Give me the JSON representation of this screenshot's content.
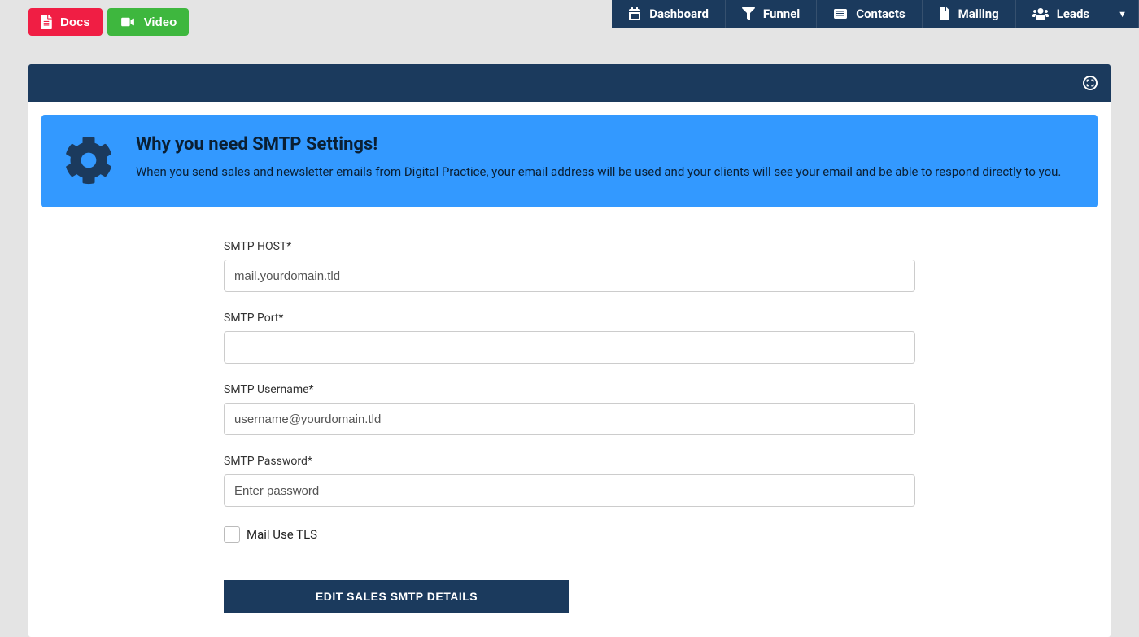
{
  "topButtons": {
    "docs": "Docs",
    "video": "Video"
  },
  "nav": {
    "dashboard": "Dashboard",
    "funnel": "Funnel",
    "contacts": "Contacts",
    "mailing": "Mailing",
    "leads": "Leads"
  },
  "banner": {
    "title": "Why you need SMTP Settings!",
    "body": "When you send sales and newsletter emails from Digital Practice, your email address will be used and your clients will see your email and be able to respond directly to you."
  },
  "form": {
    "host_label": "SMTP HOST*",
    "host_placeholder": "mail.yourdomain.tld",
    "port_label": "SMTP Port*",
    "port_value": "",
    "username_label": "SMTP Username*",
    "username_placeholder": "username@yourdomain.tld",
    "password_label": "SMTP Password*",
    "password_placeholder": "Enter password",
    "tls_label": "Mail Use TLS",
    "submit": "EDIT SALES SMTP DETAILS"
  }
}
